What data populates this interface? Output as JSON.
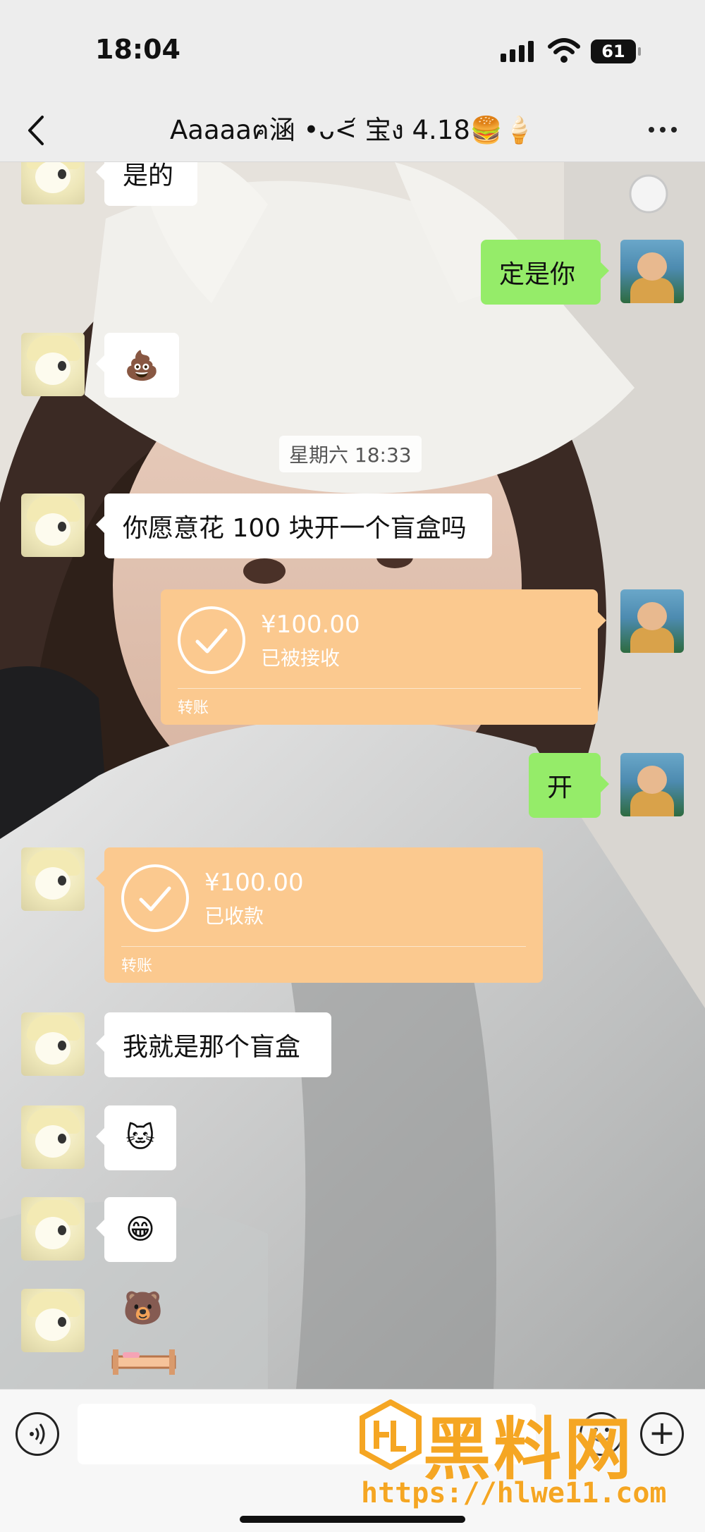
{
  "status_bar": {
    "time": "18:04",
    "battery": "61"
  },
  "header": {
    "title": "Aaaaaฅ涵 •ᴗ<᷄ 宝ง 4.18🍔🍦"
  },
  "chat": {
    "timestamp": "星期六 18:33",
    "messages": [
      {
        "side": "left",
        "type": "text",
        "text": "是的"
      },
      {
        "side": "right",
        "type": "text",
        "text": "定是你"
      },
      {
        "side": "left",
        "type": "emoji",
        "text": "💩"
      },
      {
        "side": "left",
        "type": "text",
        "text": "你愿意花 100 块开一个盲盒吗"
      },
      {
        "side": "right",
        "type": "transfer",
        "amount": "¥100.00",
        "status": "已被接收",
        "kind": "转账"
      },
      {
        "side": "right",
        "type": "text",
        "text": "开"
      },
      {
        "side": "left",
        "type": "transfer",
        "amount": "¥100.00",
        "status": "已收款",
        "kind": "转账"
      },
      {
        "side": "left",
        "type": "text",
        "text": "我就是那个盲盒"
      },
      {
        "side": "left",
        "type": "emoji",
        "text": "🐱"
      },
      {
        "side": "left",
        "type": "emoji",
        "text": "😁"
      },
      {
        "side": "left",
        "type": "sticker",
        "text": "🐻"
      }
    ]
  },
  "input_bar": {
    "placeholder": ""
  },
  "watermark": {
    "text": "黑料网",
    "url": "https://hlwe11.com"
  },
  "colors": {
    "green_bubble": "#95ec69",
    "transfer_card": "#fbc98f",
    "watermark": "#f5a623"
  }
}
